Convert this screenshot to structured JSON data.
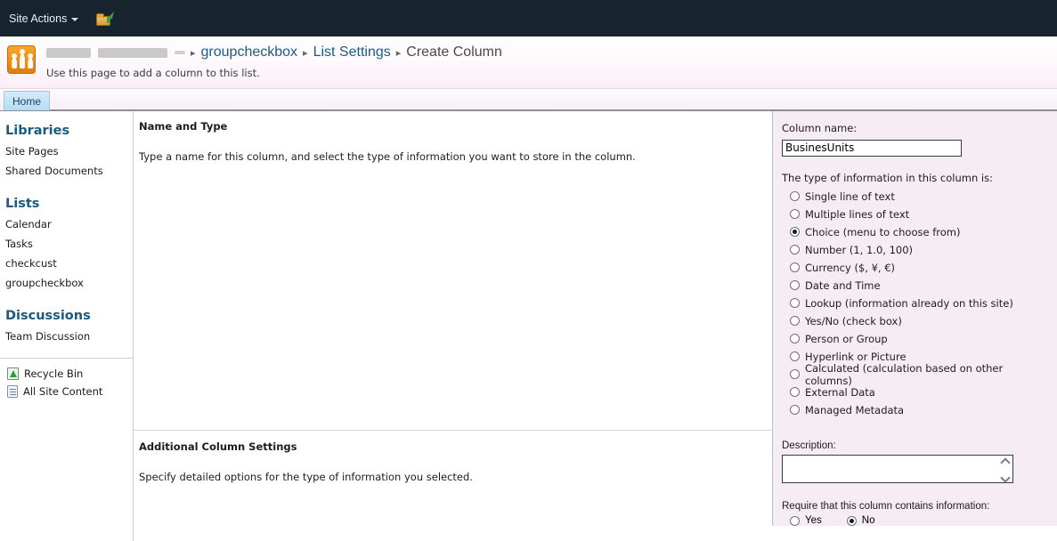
{
  "topbar": {
    "site_actions_label": "Site Actions",
    "navigate_up_icon": "navigate-up-folder-icon"
  },
  "header": {
    "breadcrumb": [
      {
        "label": "",
        "redacted": true
      },
      {
        "label": "groupcheckbox",
        "redacted": false
      },
      {
        "label": "List Settings",
        "redacted": false
      },
      {
        "label": "Create Column",
        "redacted": false
      }
    ],
    "page_description": "Use this page to add a column to this list.",
    "logo_icon": "team-site-people-icon"
  },
  "ribbon": {
    "tabs": [
      {
        "label": "Home",
        "selected": true
      }
    ]
  },
  "sidebar": {
    "groups": [
      {
        "heading": "Libraries",
        "items": [
          {
            "label": "Site Pages"
          },
          {
            "label": "Shared Documents"
          }
        ]
      },
      {
        "heading": "Lists",
        "items": [
          {
            "label": "Calendar"
          },
          {
            "label": "Tasks"
          },
          {
            "label": "checkcust"
          },
          {
            "label": "groupcheckbox"
          }
        ]
      },
      {
        "heading": "Discussions",
        "items": [
          {
            "label": "Team Discussion"
          }
        ]
      }
    ],
    "bottom_links": [
      {
        "label": "Recycle Bin",
        "icon": "recycle-bin-icon"
      },
      {
        "label": "All Site Content",
        "icon": "all-site-content-icon"
      }
    ]
  },
  "main": {
    "name_and_type": {
      "title": "Name and Type",
      "description": "Type a name for this column, and select the type of information you want to store in the column."
    },
    "additional_settings": {
      "title": "Additional Column Settings",
      "description": "Specify detailed options for the type of information you selected."
    }
  },
  "form": {
    "column_name_label": "Column name:",
    "column_name_value": "BusinesUnits",
    "type_label": "The type of information in this column is:",
    "type_options": [
      {
        "label": "Single line of text",
        "selected": false
      },
      {
        "label": "Multiple lines of text",
        "selected": false
      },
      {
        "label": "Choice (menu to choose from)",
        "selected": true
      },
      {
        "label": "Number (1, 1.0, 100)",
        "selected": false
      },
      {
        "label": "Currency ($, ¥, €)",
        "selected": false
      },
      {
        "label": "Date and Time",
        "selected": false
      },
      {
        "label": "Lookup (information already on this site)",
        "selected": false
      },
      {
        "label": "Yes/No (check box)",
        "selected": false
      },
      {
        "label": "Person or Group",
        "selected": false
      },
      {
        "label": "Hyperlink or Picture",
        "selected": false
      },
      {
        "label": "Calculated (calculation based on other columns)",
        "selected": false
      },
      {
        "label": "External Data",
        "selected": false
      },
      {
        "label": "Managed Metadata",
        "selected": false
      }
    ],
    "description_label": "Description:",
    "description_value": "",
    "require_label": "Require that this column contains information:",
    "require_options": [
      {
        "label": "Yes",
        "selected": false
      },
      {
        "label": "No",
        "selected": true
      }
    ]
  },
  "colors": {
    "topbar_bg": "#17242e",
    "right_pane_bg": "#f6ecf3",
    "accent_link": "#1a5a80",
    "tab_selected_bg": "#b6dcf2",
    "logo_orange": "#e07c10"
  }
}
